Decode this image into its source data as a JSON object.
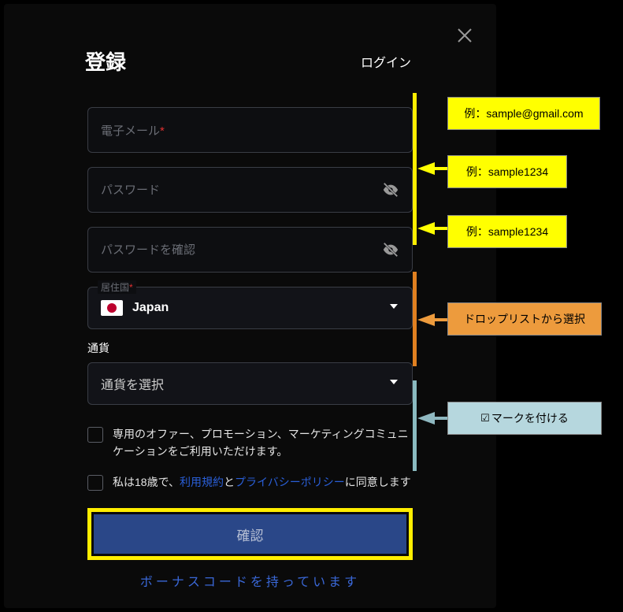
{
  "header": {
    "title": "登録",
    "login": "ログイン"
  },
  "email": {
    "placeholder_head": "電子メール",
    "required_mark": "*"
  },
  "password": {
    "placeholder": "パスワード"
  },
  "password_confirm": {
    "placeholder": "パスワードを確認"
  },
  "country": {
    "label": "居住国",
    "required_mark": "*",
    "value": "Japan"
  },
  "currency": {
    "label": "通貨",
    "placeholder": "通貨を選択"
  },
  "marketing": {
    "text": "専用のオファー、プロモーション、マーケティングコミュニケーションをご利用いただけます。"
  },
  "terms": {
    "prefix": "私は18歳で、",
    "terms_link": "利用規約",
    "and": "と",
    "privacy_link": "プライバシーポリシー",
    "suffix": "に同意します"
  },
  "confirm_btn": "確認",
  "bonus_link": "ボーナスコードを持っています",
  "callouts": {
    "email": "例：sample@gmail.com",
    "password": "例：sample1234",
    "password2": "例：sample1234",
    "dropdown": "ドロップリストから選択",
    "check_symbol": "☑",
    "check_text": "マークを付ける"
  }
}
